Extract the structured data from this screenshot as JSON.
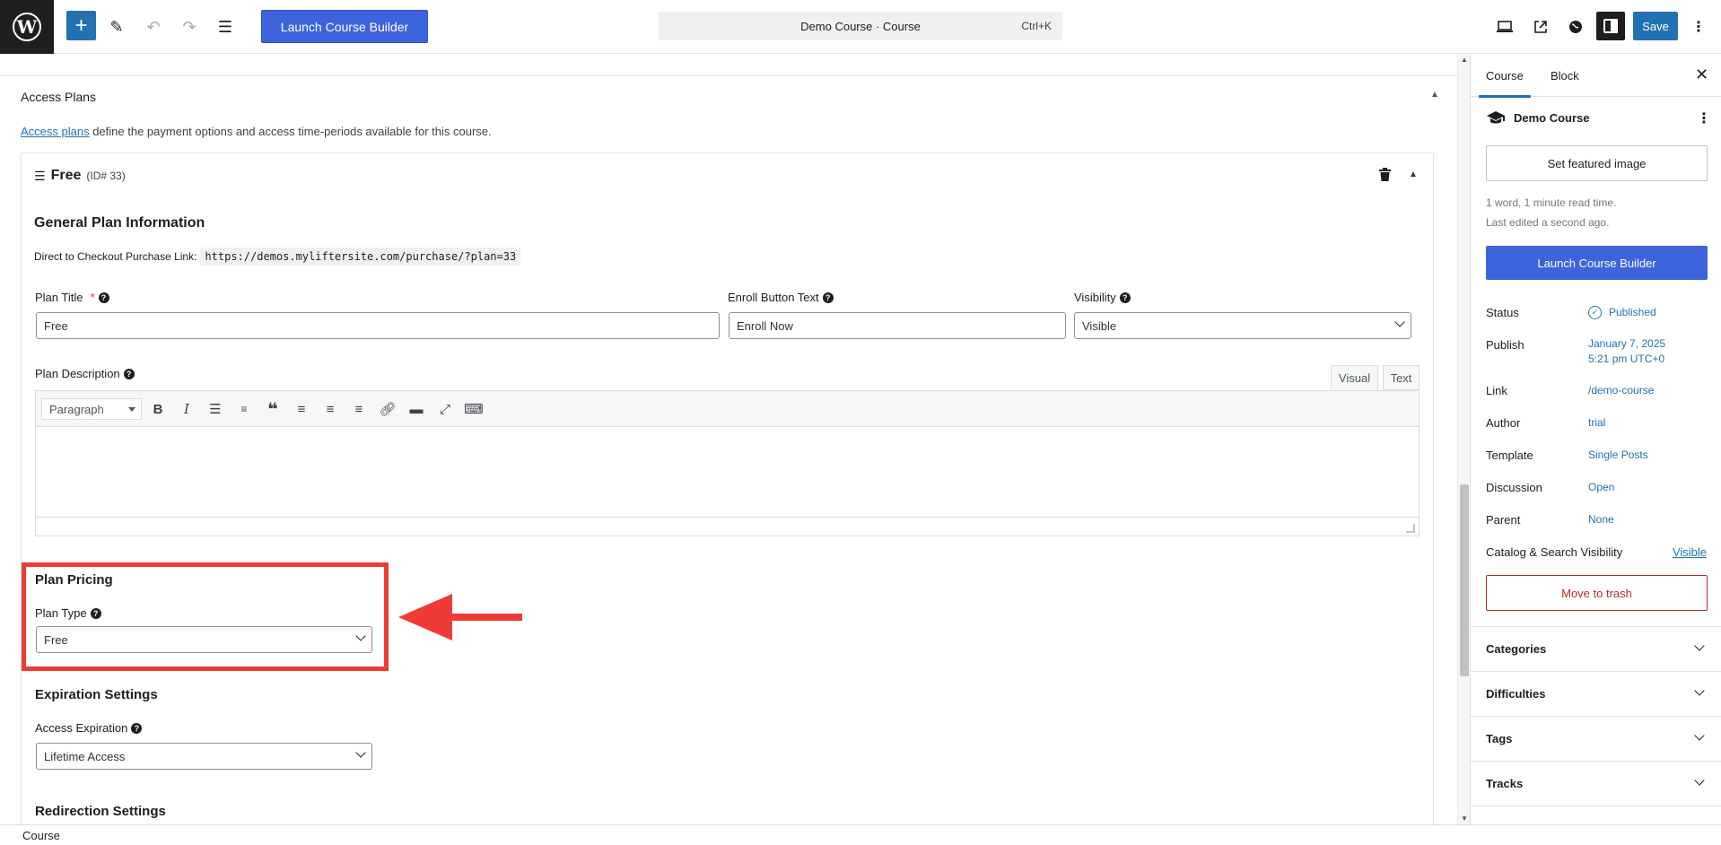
{
  "topbar": {
    "launch_label": "Launch Course Builder",
    "command_title": "Demo Course · Course",
    "command_shortcut": "Ctrl+K",
    "save_label": "Save"
  },
  "access_plans": {
    "section_title": "Access Plans",
    "desc_link": "Access plans",
    "desc_rest": " define the payment options and access time-periods available for this course.",
    "plan_name": "Free",
    "plan_id": "(ID# 33)"
  },
  "general": {
    "heading": "General Plan Information",
    "checkout_label": "Direct to Checkout Purchase Link:",
    "checkout_url": "https://demos.myliftersite.com/purchase/?plan=33",
    "plan_title_label": "Plan Title",
    "plan_title_required": "*",
    "plan_title_value": "Free",
    "enroll_label": "Enroll Button Text",
    "enroll_value": "Enroll Now",
    "visibility_label": "Visibility",
    "visibility_value": "Visible",
    "description_label": "Plan Description"
  },
  "editor": {
    "tab_visual": "Visual",
    "tab_text": "Text",
    "format_value": "Paragraph"
  },
  "pricing": {
    "heading": "Plan Pricing",
    "type_label": "Plan Type",
    "type_value": "Free"
  },
  "expiration": {
    "heading": "Expiration Settings",
    "label": "Access Expiration",
    "value": "Lifetime Access"
  },
  "redirection": {
    "heading": "Redirection Settings"
  },
  "bottom": {
    "breadcrumb": "Course"
  },
  "sidebar": {
    "tab_course": "Course",
    "tab_block": "Block",
    "title": "Demo Course",
    "featured_label": "Set featured image",
    "meta_words": "1 word, 1 minute read time.",
    "meta_edited": "Last edited a second ago.",
    "launch_label": "Launch Course Builder",
    "rows": {
      "status_label": "Status",
      "status_value": "Published",
      "publish_label": "Publish",
      "publish_value_1": "January 7, 2025",
      "publish_value_2": "5:21 pm UTC+0",
      "link_label": "Link",
      "link_value": "/demo-course",
      "author_label": "Author",
      "author_value": "trial",
      "template_label": "Template",
      "template_value": "Single Posts",
      "discussion_label": "Discussion",
      "discussion_value": "Open",
      "parent_label": "Parent",
      "parent_value": "None",
      "catalog_label": "Catalog & Search Visibility",
      "catalog_value": "Visible"
    },
    "trash_label": "Move to trash",
    "panels": {
      "categories": "Categories",
      "difficulties": "Difficulties",
      "tags": "Tags",
      "tracks": "Tracks"
    }
  }
}
